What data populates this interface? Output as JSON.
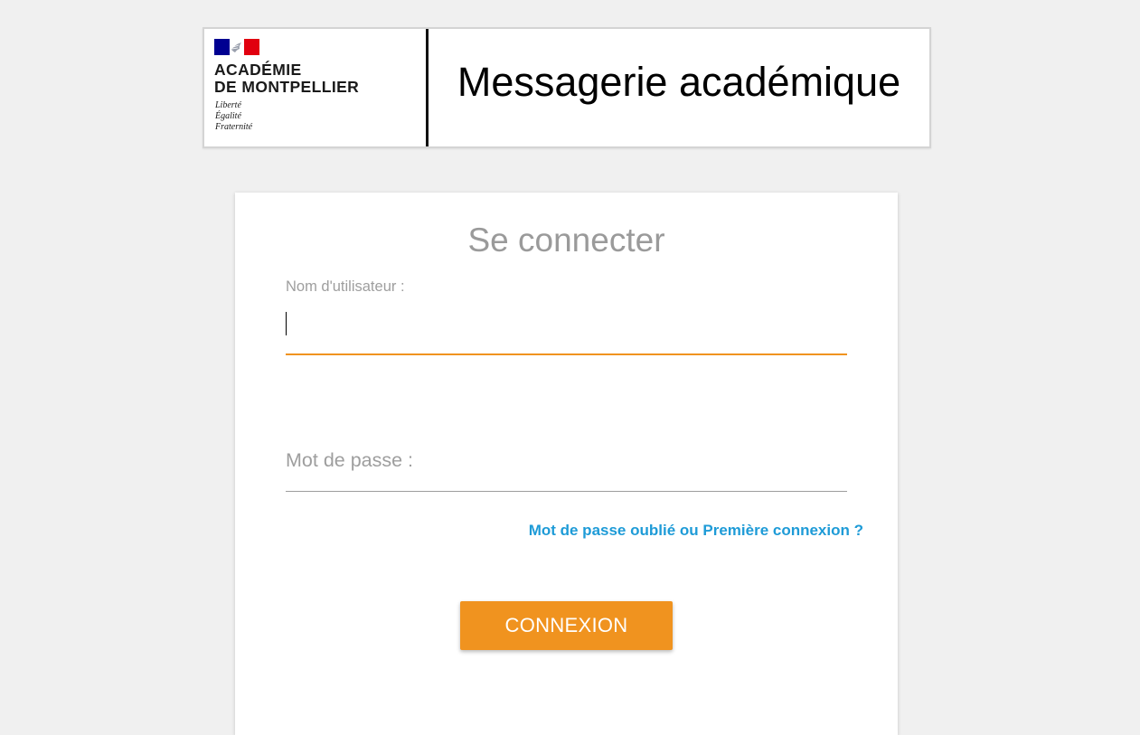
{
  "header": {
    "org_line1": "ACADÉMIE",
    "org_line2": "DE MONTPELLIER",
    "motto": [
      "Liberté",
      "Égalité",
      "Fraternité"
    ],
    "site_title": "Messagerie académique"
  },
  "login": {
    "title": "Se connecter",
    "username_label": "Nom d'utilisateur :",
    "username_value": "",
    "password_label": "Mot de passe :",
    "forgot_link": "Mot de passe oublié ou Première connexion ?",
    "submit_label": "CONNEXION"
  },
  "icons": {
    "flag": "marianne-flag-icon"
  },
  "colors": {
    "accent": "#f0931f",
    "link": "#1e9bd7",
    "muted_text": "#9e9e9e",
    "background": "#f0f0f0",
    "flag_blue": "#000091",
    "flag_red": "#e1000f"
  }
}
